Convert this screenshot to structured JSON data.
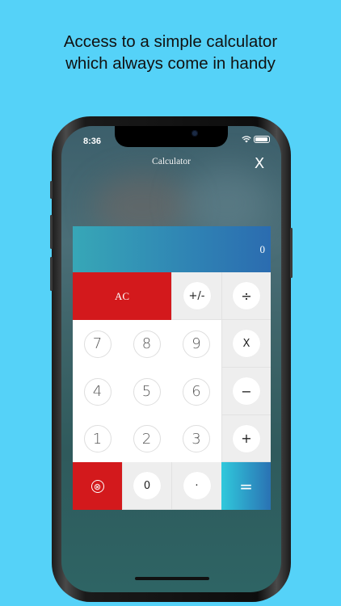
{
  "caption": {
    "line1": "Access to a simple calculator",
    "line2": "which always come in handy"
  },
  "status_bar": {
    "time": "8:36"
  },
  "app": {
    "title": "Calculator",
    "close_label": "X",
    "display_value": "0"
  },
  "keys": {
    "ac": "AC",
    "sign": "+/-",
    "divide": "÷",
    "multiply": "X",
    "minus": "−",
    "plus": "+",
    "equals": "=",
    "seven": "7",
    "eight": "8",
    "nine": "9",
    "four": "4",
    "five": "5",
    "six": "6",
    "one": "1",
    "two": "2",
    "three": "3",
    "zero": "0",
    "dot": "·",
    "delete": "⊗"
  },
  "colors": {
    "background": "#55d2f8",
    "accent_red": "#d3191c",
    "display_gradient_start": "#37a7b7",
    "display_gradient_end": "#2b6cb0"
  }
}
